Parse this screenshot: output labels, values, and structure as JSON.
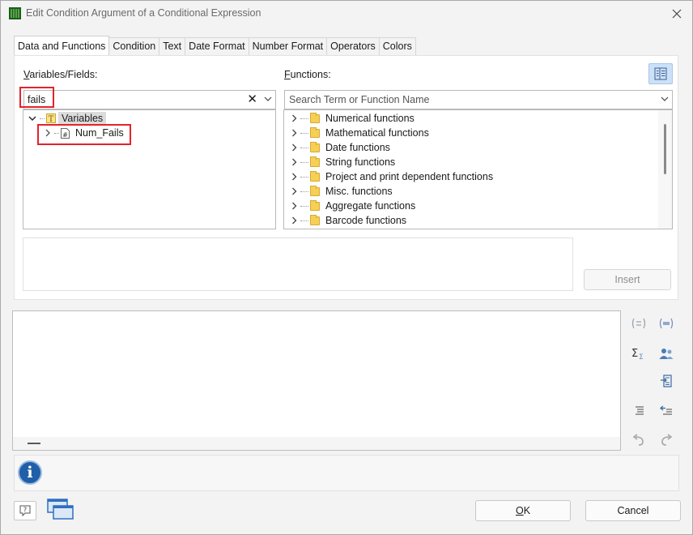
{
  "window": {
    "title": "Edit Condition Argument of a Conditional Expression"
  },
  "tabs": [
    {
      "label": "Data and Functions",
      "active": true
    },
    {
      "label": "Condition"
    },
    {
      "label": "Text"
    },
    {
      "label": "Date Format"
    },
    {
      "label": "Number Format"
    },
    {
      "label": "Operators"
    },
    {
      "label": "Colors"
    }
  ],
  "variables": {
    "label_accel": "V",
    "label_rest": "ariables/Fields:",
    "search_value": "fails",
    "tree": {
      "root": "Variables",
      "children": [
        "Num_Fails"
      ]
    }
  },
  "functions": {
    "label_accel": "F",
    "label_rest": "unctions:",
    "search_placeholder": "Search Term or Function Name",
    "items": [
      "Numerical functions",
      "Mathematical functions",
      "Date functions",
      "String functions",
      "Project and print dependent functions",
      "Misc. functions",
      "Aggregate functions",
      "Barcode functions"
    ]
  },
  "buttons": {
    "insert": "Insert",
    "ok_accel": "O",
    "ok_rest": "K",
    "cancel": "Cancel"
  },
  "icons": {
    "app": "app-grid-icon",
    "close": "close-icon",
    "layout_toggle": "layout-toggle-icon",
    "info": "info-icon",
    "help": "help-icon",
    "windows": "windows-icon"
  },
  "colors": {
    "highlight": "#e3232c",
    "accent": "#cce0f7",
    "folder": "#f6cf57"
  }
}
